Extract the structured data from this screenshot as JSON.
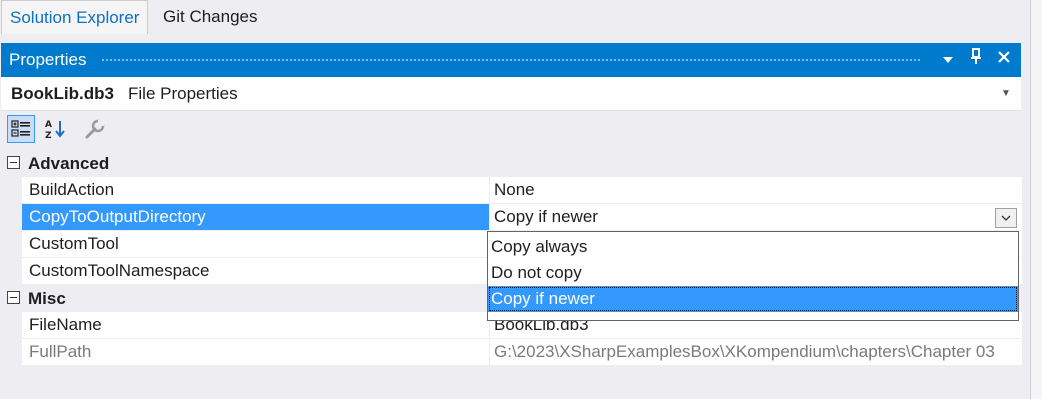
{
  "tabs": [
    {
      "label": "Solution Explorer",
      "active": true
    },
    {
      "label": "Git Changes",
      "active": false
    }
  ],
  "panel": {
    "title": "Properties",
    "buttons": {
      "dropdown": "▾",
      "pin": "⊥",
      "close": "✕"
    }
  },
  "object_selector": {
    "name": "BookLib.db3",
    "kind": "File Properties"
  },
  "toolbar": {
    "icons": [
      "categorized-icon",
      "alphabetical-sort-icon",
      "property-pages-wrench-icon"
    ]
  },
  "categories": {
    "advanced": {
      "label": "Advanced",
      "props": [
        {
          "name": "BuildAction",
          "value": "None"
        },
        {
          "name": "CopyToOutputDirectory",
          "value": "Copy if newer"
        },
        {
          "name": "CustomTool",
          "value": ""
        },
        {
          "name": "CustomToolNamespace",
          "value": ""
        }
      ]
    },
    "misc": {
      "label": "Misc",
      "props": [
        {
          "name": "FileName",
          "value": "BookLib.db3"
        },
        {
          "name": "FullPath",
          "value": "G:\\2023\\XSharpExamplesBox\\XKompendium\\chapters\\Chapter 03"
        }
      ]
    }
  },
  "dropdown_options": [
    "Copy always",
    "Do not copy",
    "Copy if newer"
  ],
  "colors": {
    "accent": "#007acc",
    "selection": "#3399ff"
  }
}
